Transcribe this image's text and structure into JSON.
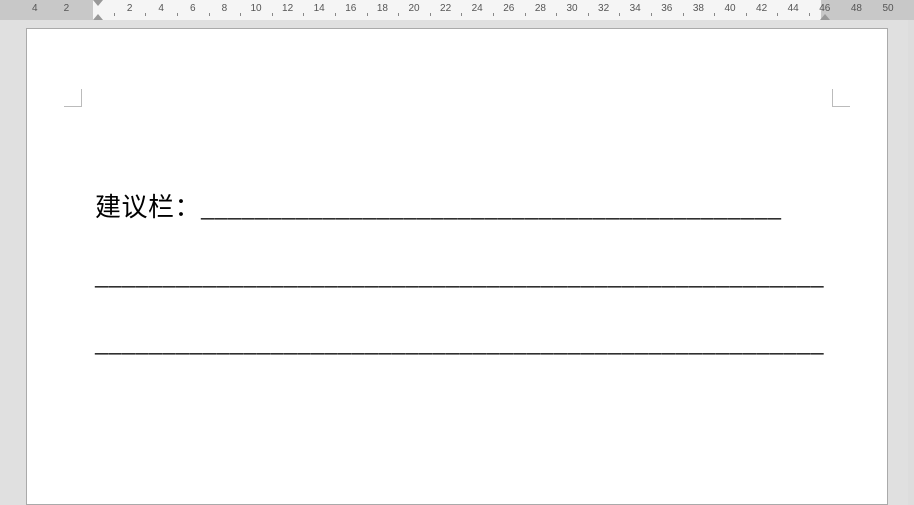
{
  "ruler": {
    "left_numbers": [
      4,
      2
    ],
    "main_numbers": [
      2,
      4,
      6,
      8,
      10,
      12,
      14,
      16,
      18,
      20,
      22,
      24,
      26,
      28,
      30,
      32,
      34,
      36,
      38,
      40,
      42,
      44,
      46
    ],
    "right_numbers": [
      48,
      50
    ]
  },
  "document": {
    "line1_label": "建议栏：",
    "line1_underscores": "___________________________________________",
    "line2": "______________________________________________________",
    "line3": "______________________________________________________"
  }
}
